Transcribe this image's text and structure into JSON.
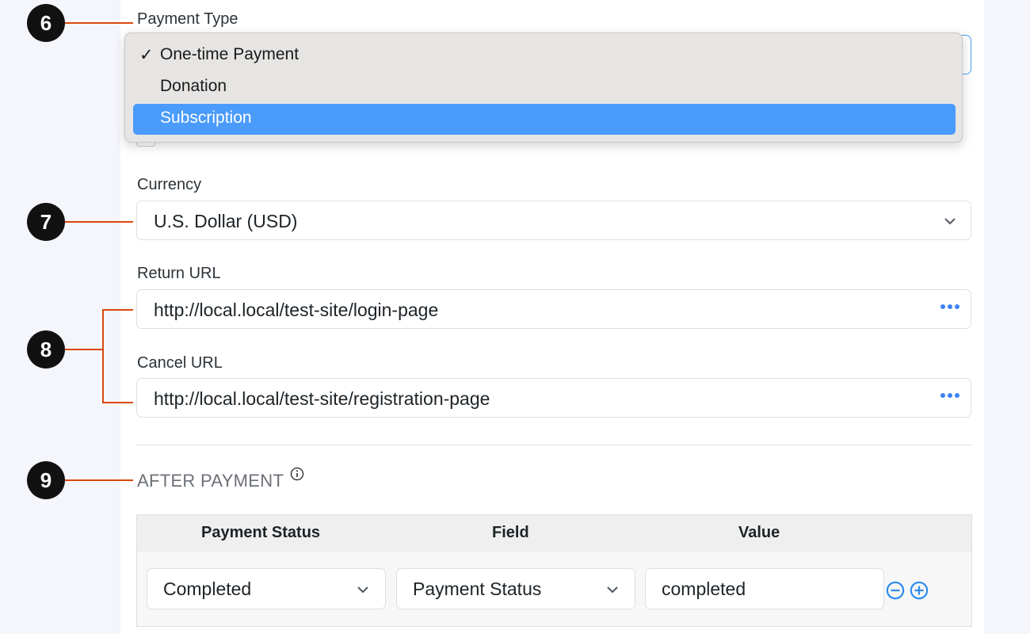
{
  "badges": [
    "6",
    "7",
    "8",
    "9"
  ],
  "payment_type": {
    "label": "Payment Type",
    "options": [
      {
        "label": "One-time Payment",
        "checked": true,
        "highlighted": false
      },
      {
        "label": "Donation",
        "checked": false,
        "highlighted": false
      },
      {
        "label": "Subscription",
        "checked": false,
        "highlighted": true
      }
    ],
    "check_glyph": "✓"
  },
  "currency": {
    "label": "Currency",
    "value": "U.S. Dollar (USD)"
  },
  "return_url": {
    "label": "Return URL",
    "value": "http://local.local/test-site/login-page"
  },
  "cancel_url": {
    "label": "Cancel URL",
    "value": "http://local.local/test-site/registration-page"
  },
  "after_payment": {
    "title": "AFTER PAYMENT",
    "columns": [
      "Payment Status",
      "Field",
      "Value"
    ],
    "row": {
      "status": "Completed",
      "field": "Payment Status",
      "value": "completed"
    }
  },
  "colors": {
    "accent": "#4a9bfb",
    "badge": "#111111",
    "leader_line": "#d9480f"
  }
}
